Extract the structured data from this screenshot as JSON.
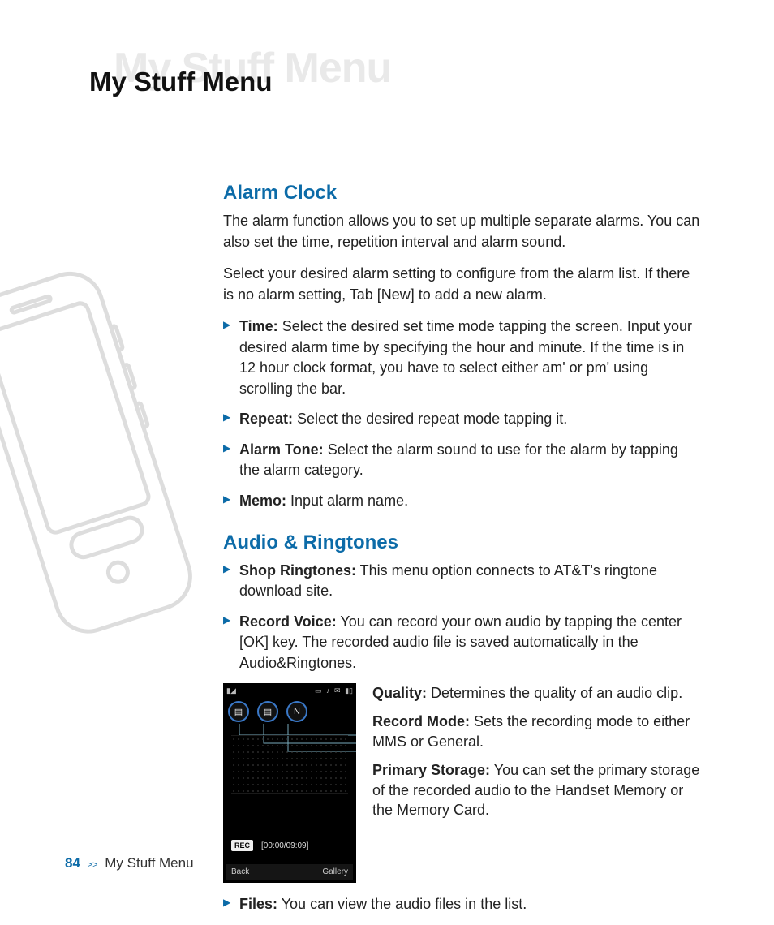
{
  "colors": {
    "accent": "#0c6ba8"
  },
  "page": {
    "watermark_title": "My Stuff Menu",
    "chapter_title": "My Stuff Menu"
  },
  "sections": {
    "alarm": {
      "heading": "Alarm Clock",
      "intro1": "The alarm function allows you to set up multiple separate alarms. You can also set the time, repetition interval and alarm sound.",
      "intro2": "Select your desired alarm setting to configure from the alarm list. If there is no alarm setting, Tab [New] to add a new alarm.",
      "items": [
        {
          "label": "Time:",
          "text": " Select the desired set time mode tapping the screen. Input your desired alarm time by specifying the hour and minute. If the time is in 12 hour clock format, you have to select either am' or pm' using scrolling the bar."
        },
        {
          "label": "Repeat:",
          "text": " Select the desired repeat mode tapping it."
        },
        {
          "label": "Alarm Tone:",
          "text": " Select the alarm sound to use for the alarm by tapping the alarm category."
        },
        {
          "label": "Memo:",
          "text": " Input alarm name."
        }
      ]
    },
    "audio": {
      "heading": "Audio & Ringtones",
      "items_top": [
        {
          "label": "Shop Ringtones:",
          "text": " This menu option connects to AT&T's ringtone download site."
        },
        {
          "label": "Record Voice:",
          "text": " You can record your own audio by tapping the center [OK] key. The recorded audio file is saved automatically in the Audio&Ringtones."
        }
      ],
      "callouts": [
        {
          "label": "Quality:",
          "text": " Determines the quality of an audio clip."
        },
        {
          "label": "Record Mode:",
          "text": " Sets the recording mode to either MMS or General."
        },
        {
          "label": "Primary Storage:",
          "text": " You can set the primary storage of the recorded audio to the Handset Memory or the Memory Card."
        }
      ],
      "items_bottom": [
        {
          "label": "Files:",
          "text": " You can view the audio files in the list."
        }
      ]
    }
  },
  "phone_shot": {
    "status_left_icon": "signal-icon",
    "status_right_icons": [
      "sd-icon",
      "music-icon",
      "msg-icon",
      "battery-icon"
    ],
    "icon_buttons": [
      "quality-icon",
      "record-mode-icon",
      "storage-icon-N"
    ],
    "rec_label": "REC",
    "rec_time": "[00:00/09:09]",
    "softkey_left": "Back",
    "softkey_right": "Gallery"
  },
  "footer": {
    "page_number": "84",
    "separator": ">>",
    "crumb": "My Stuff Menu"
  }
}
